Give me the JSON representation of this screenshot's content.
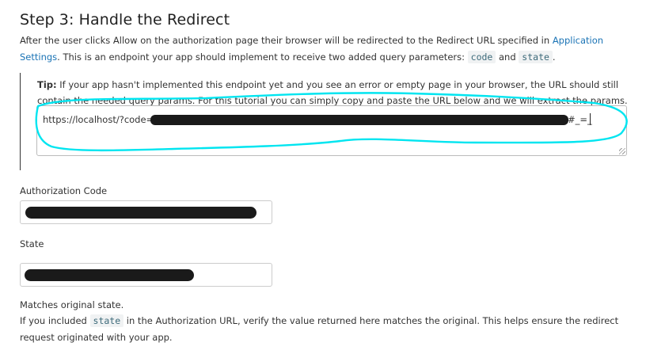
{
  "step": {
    "title": "Step 3: Handle the Redirect",
    "intro_a": "After the user clicks Allow on the authorization page their browser will be redirected to the Redirect URL specified in ",
    "intro_link": "Application Settings",
    "intro_b": ". This is an endpoint your app should implement to receive two added query parameters: ",
    "param_code": "code",
    "intro_and": " and ",
    "param_state": "state",
    "intro_end": "."
  },
  "tip": {
    "label": "Tip:",
    "text": " If your app hasn't implemented this endpoint yet and you see an error or empty page in your browser, the URL should still contain the needed query params. For this tutorial you can simply copy and paste the URL below and we will extract the params."
  },
  "url_input": {
    "value_prefix": "https://localhost/?code=7",
    "value_suffix": "#_=_"
  },
  "fields": {
    "auth_code_label": "Authorization Code",
    "state_label": "State"
  },
  "matches": {
    "title": "Matches original state.",
    "text_a": "If you included ",
    "param_state": "state",
    "text_b": " in the Authorization URL, verify the value returned here matches the original. This helps ensure the redirect request originated with your app."
  },
  "colors": {
    "link": "#1a73b5",
    "annotation": "#00e5f0",
    "redaction": "#1a1a1a"
  }
}
